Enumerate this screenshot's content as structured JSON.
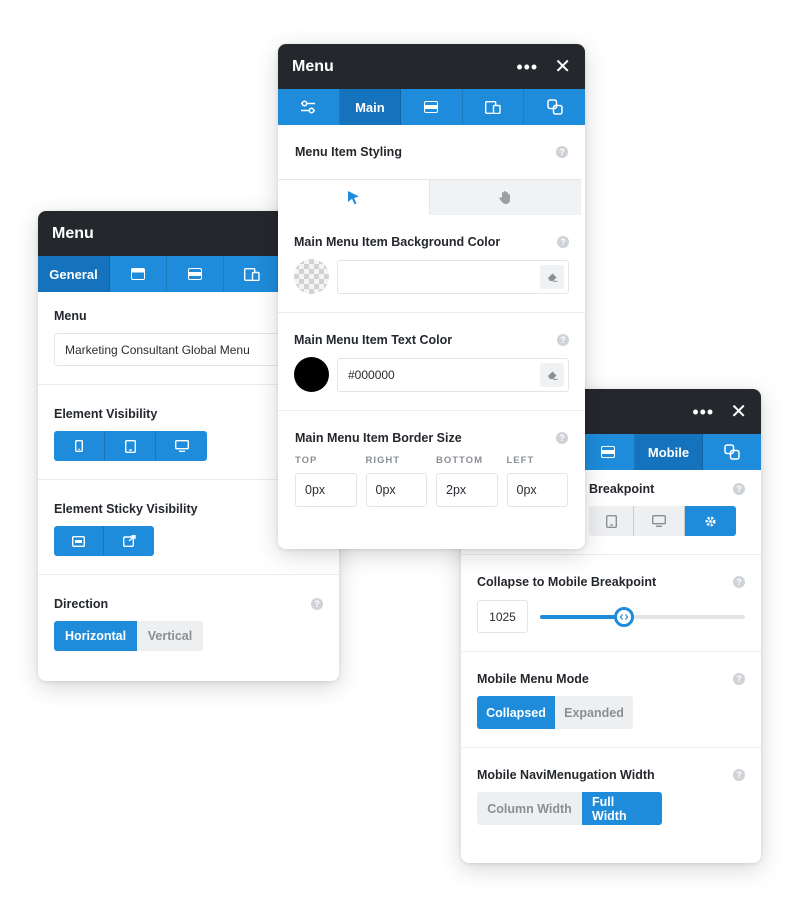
{
  "left_panel": {
    "title": "Menu",
    "tabs": [
      "General"
    ],
    "menu_label": "Menu",
    "menu_value": "Marketing Consultant Global Menu",
    "visibility_label": "Element Visibility",
    "sticky_label": "Element Sticky Visibility",
    "direction_label": "Direction",
    "direction_options": [
      "Horizontal",
      "Vertical"
    ],
    "direction_selected": "Horizontal"
  },
  "middle_panel": {
    "title": "Menu",
    "tabs": [
      "Main"
    ],
    "styling_label": "Menu Item Styling",
    "bg_color_label": "Main Menu Item Background Color",
    "bg_color_value": "",
    "text_color_label": "Main Menu Item Text Color",
    "text_color_value": "#000000",
    "border_label": "Main Menu Item Border Size",
    "border_sides": [
      {
        "label": "TOP",
        "value": "0px"
      },
      {
        "label": "RIGHT",
        "value": "0px"
      },
      {
        "label": "BOTTOM",
        "value": "2px"
      },
      {
        "label": "LEFT",
        "value": "0px"
      }
    ]
  },
  "right_panel": {
    "tabs": [
      "Mobile"
    ],
    "breakpoint_label": "Breakpoint",
    "collapse_label": "Collapse to Mobile Breakpoint",
    "collapse_value": "1025",
    "slider_fraction": 0.41,
    "mode_label": "Mobile Menu Mode",
    "mode_options": [
      "Collapsed",
      "Expanded"
    ],
    "mode_selected": "Collapsed",
    "width_label": "Mobile NaviMenugation Width",
    "width_options": [
      "Column Width",
      "Full Width"
    ],
    "width_selected": "Full Width"
  },
  "help_glyph": "?",
  "colors": {
    "accent": "#1e8cda",
    "accent_dark": "#1572bc",
    "titlebar": "#24282d",
    "muted": "#eeeff1"
  },
  "icons": [
    "ellipsis-icon",
    "close-icon",
    "sliders-icon",
    "layout-icon",
    "responsive-icon",
    "link-icon",
    "mobile-icon",
    "tablet-icon",
    "desktop-icon",
    "gear-icon",
    "cursor-icon",
    "hand-icon",
    "eraser-icon"
  ]
}
